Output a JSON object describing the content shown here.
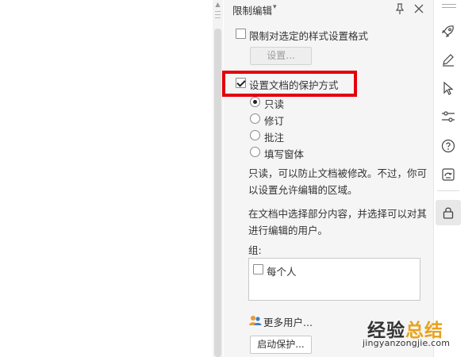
{
  "panel": {
    "title": "限制编辑",
    "title_caret": "▾",
    "format_restriction": {
      "checkbox_label": "限制对选定的样式设置格式",
      "checked": false,
      "settings_button": "设置..."
    },
    "protection_mode": {
      "checkbox_label": "设置文档的保护方式",
      "checked": true,
      "options": [
        {
          "label": "只读",
          "selected": true
        },
        {
          "label": "修订",
          "selected": false
        },
        {
          "label": "批注",
          "selected": false
        },
        {
          "label": "填写窗体",
          "selected": false
        }
      ]
    },
    "description_1": "只读，可以防止文档被修改。不过，你可以设置允许编辑的区域。",
    "description_2": "在文档中选择部分内容，并选择可以对其进行编辑的用户。",
    "group_label": "组:",
    "groups": [
      {
        "label": "每个人",
        "checked": false
      }
    ],
    "more_users_link": "更多用户...",
    "start_protection_button": "启动保护..."
  },
  "right_rail": {
    "icons": [
      "rocket-icon",
      "pen-icon",
      "cursor-icon",
      "adjust-icon",
      "help-icon",
      "backup-icon",
      "lock-icon"
    ],
    "active": "lock-icon"
  },
  "watermark": {
    "title_part1": "经验",
    "title_part2": "总结",
    "url": "jingyanzongjie.com"
  },
  "colors": {
    "highlight": "#e5000a",
    "panel_bg": "#f5f5f5",
    "watermark_accent": "#e8a21a"
  }
}
